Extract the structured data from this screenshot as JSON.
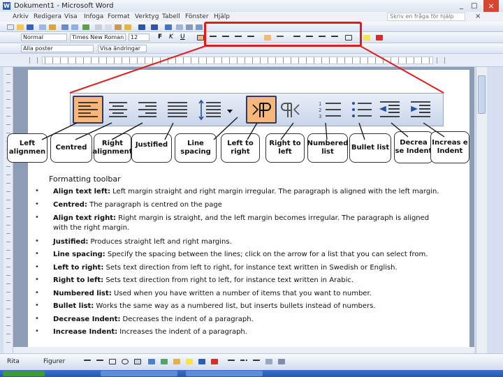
{
  "window": {
    "title": "Dokument1 - Microsoft Word",
    "controls": [
      "_",
      "□",
      "×"
    ]
  },
  "menu": {
    "items": [
      "Arkiv",
      "Redigera",
      "Visa",
      "Infoga",
      "Format",
      "Verktyg",
      "Tabell",
      "Fönster",
      "Hjälp"
    ],
    "help_placeholder": "Skriv en fråga för hjälp",
    "close": "×"
  },
  "toolbar": {
    "style_value": "Normal",
    "font_value": "Times New Roman",
    "size_value": "12",
    "bold": "F",
    "italic": "K",
    "underline": "U",
    "reviewing_value": "Alla poster",
    "show_label": "Visa ändringar"
  },
  "callouts": {
    "left": "Left alignmen",
    "centred": "Centred",
    "right": "Right alignment",
    "justified": "Justified",
    "line_spacing": "Line spacing",
    "ltr": "Left to right",
    "rtl": "Right to left",
    "numbered": "Numbered list",
    "bullet": "Bullet list",
    "decrease": "Decrea se Indent",
    "increase": "Increas e Indent"
  },
  "section_title": "Formatting toolbar",
  "items": [
    {
      "term": "Align text left:",
      "desc": " Left margin straight and right margin irregular. The paragraph is aligned with the left margin."
    },
    {
      "term": "Centred:",
      "desc": " The paragraph is centred on the page"
    },
    {
      "term": "Align text right:",
      "desc": " Right margin is straight, and the left margin becomes irregular. The paragraph is aligned with the right margin."
    },
    {
      "term": "Justified:",
      "desc": " Produces straight left and right margins."
    },
    {
      "term": "Line spacing:",
      "desc": " Specify the spacing between the lines; click on the arrow for a list that you can select from."
    },
    {
      "term": "Left to right:",
      "desc": " Sets text direction from left to right, for instance text written in Swedish or English."
    },
    {
      "term": "Right to left:",
      "desc": " Sets text direction from right to left, for instance text written in Arabic."
    },
    {
      "term": "Numbered list:",
      "desc": " Used when you have written a number of items that you want to number."
    },
    {
      "term": "Bullet list:",
      "desc": " Works the same way as a numbered list, but inserts bullets instead of numbers."
    },
    {
      "term": "Decrease Indent:",
      "desc": " Decreases the indent of a paragraph."
    },
    {
      "term": "Increase Indent:",
      "desc": " Increases the indent of a paragraph."
    }
  ],
  "drawing": {
    "draw_label": "Rita",
    "autoshapes_label": "Figurer"
  },
  "bullet_char": "•",
  "colors": {
    "highlight": "#f8b77a",
    "callout_border": "#e01d1d",
    "pointer": "#e01d1d"
  }
}
